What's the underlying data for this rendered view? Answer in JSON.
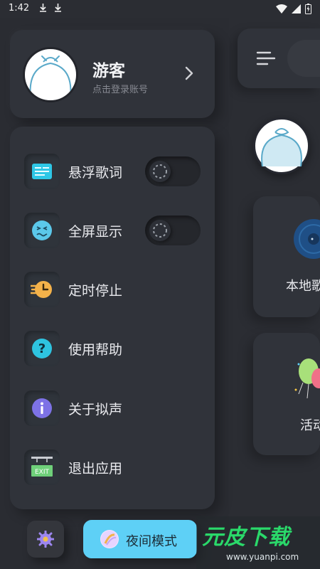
{
  "status_bar": {
    "time": "1:42"
  },
  "drawer": {
    "user": {
      "name": "游客",
      "subtitle": "点击登录账号"
    },
    "items": [
      {
        "label": "悬浮歌词",
        "icon": "lyrics-icon",
        "toggle": false
      },
      {
        "label": "全屏显示",
        "icon": "fullscreen-face-icon",
        "toggle": false
      },
      {
        "label": "定时停止",
        "icon": "timer-icon"
      },
      {
        "label": "使用帮助",
        "icon": "help-icon"
      },
      {
        "label": "关于拟声",
        "icon": "info-icon"
      },
      {
        "label": "退出应用",
        "icon": "exit-sign-icon"
      }
    ],
    "night_mode_label": "夜间模式"
  },
  "background": {
    "local_music_label": "本地歌",
    "activity_label": "活动"
  },
  "watermark": {
    "title": "元皮下载",
    "url": "www.yuanpi.com"
  },
  "colors": {
    "background": "#2b2d33",
    "card": "#30333a",
    "accent": "#5ed0f6"
  }
}
